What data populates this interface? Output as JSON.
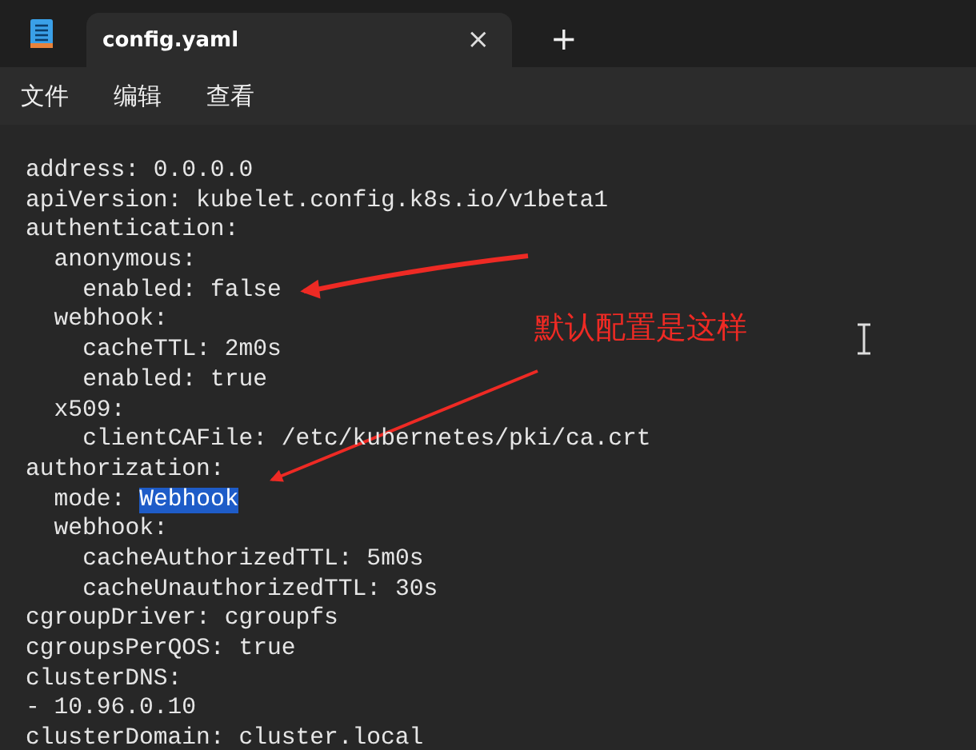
{
  "tabs": [
    {
      "title": "config.yaml",
      "selected": true,
      "close": "×"
    }
  ],
  "new_tab": "+",
  "menu": [
    "文件",
    "编辑",
    "查看"
  ],
  "editor": {
    "lines": [
      {
        "text": "address: 0.0.0.0"
      },
      {
        "text": "apiVersion: kubelet.config.k8s.io/v1beta1"
      },
      {
        "text": "authentication:",
        "children": [
          {
            "text": "anonymous:",
            "children": [
              {
                "text": "enabled: false"
              }
            ]
          },
          {
            "text": "webhook:",
            "children": [
              {
                "text": "cacheTTL: 2m0s"
              },
              {
                "text": "enabled: true"
              }
            ]
          },
          {
            "text": "x509:",
            "children": [
              {
                "text": "clientCAFile: /etc/kubernetes/pki/ca.crt"
              }
            ]
          }
        ]
      },
      {
        "text": "authorization:",
        "children": [
          {
            "text": "mode: ",
            "selection": "Webhook"
          },
          {
            "text": "webhook:",
            "children": [
              {
                "text": "cacheAuthorizedTTL: 5m0s"
              },
              {
                "text": "cacheUnauthorizedTTL: 30s"
              }
            ]
          }
        ]
      },
      {
        "text": "cgroupDriver: cgroupfs"
      },
      {
        "text": "cgroupsPerQOS: true"
      },
      {
        "text": "clusterDNS:"
      },
      {
        "text": "- 10.96.0.10"
      },
      {
        "text": "clusterDomain: cluster.local"
      }
    ]
  },
  "annotation": {
    "text": "默认配置是这样"
  }
}
